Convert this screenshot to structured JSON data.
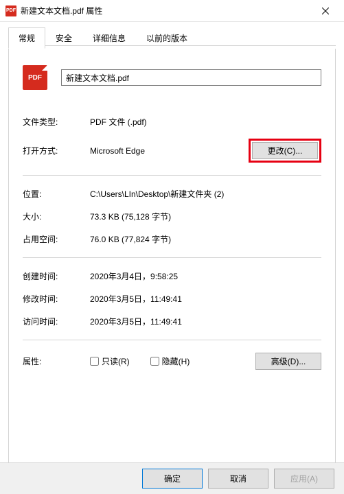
{
  "titlebar": {
    "icon_text": "PDF",
    "title": "新建文本文档.pdf 属性"
  },
  "tabs": {
    "general": "常规",
    "security": "安全",
    "details": "详细信息",
    "previous": "以前的版本"
  },
  "file": {
    "icon_text": "PDF",
    "name": "新建文本文档.pdf"
  },
  "labels": {
    "filetype": "文件类型:",
    "openwith": "打开方式:",
    "location": "位置:",
    "size": "大小:",
    "size_on_disk": "占用空间:",
    "created": "创建时间:",
    "modified": "修改时间:",
    "accessed": "访问时间:",
    "attributes": "属性:",
    "readonly": "只读(R)",
    "hidden": "隐藏(H)"
  },
  "values": {
    "filetype": "PDF 文件 (.pdf)",
    "openwith": "Microsoft Edge",
    "location": "C:\\Users\\LIn\\Desktop\\新建文件夹 (2)",
    "size": "73.3 KB (75,128 字节)",
    "size_on_disk": "76.0 KB (77,824 字节)",
    "created": "2020年3月4日，9:58:25",
    "modified": "2020年3月5日，11:49:41",
    "accessed": "2020年3月5日，11:49:41"
  },
  "buttons": {
    "change": "更改(C)...",
    "advanced": "高级(D)...",
    "ok": "确定",
    "cancel": "取消",
    "apply": "应用(A)"
  }
}
